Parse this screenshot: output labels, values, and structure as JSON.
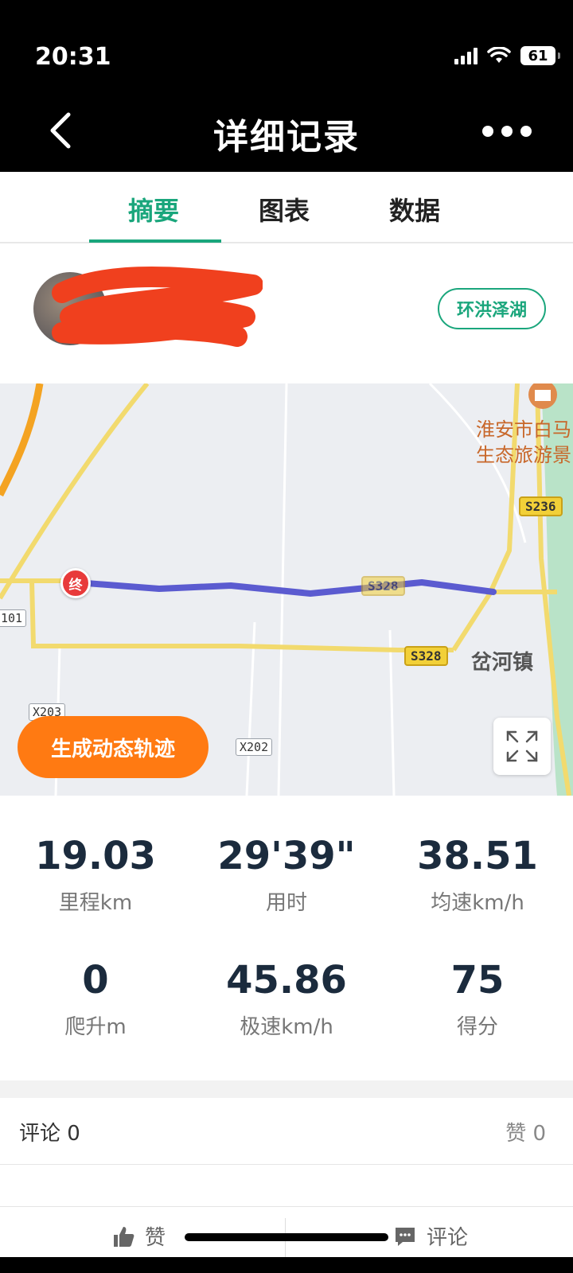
{
  "status_bar": {
    "time": "20:31",
    "battery": "61"
  },
  "header": {
    "title": "详细记录"
  },
  "tabs": [
    {
      "label": "摘要",
      "active": true
    },
    {
      "label": "图表",
      "active": false
    },
    {
      "label": "数据",
      "active": false
    }
  ],
  "user": {
    "route_tag": "环洪泽湖"
  },
  "map": {
    "poi_line1": "淮安市白马",
    "poi_line2": "生态旅游景",
    "road_s236": "S236",
    "road_s328_track": "S328",
    "road_s328": "S328",
    "road_x203": "X203",
    "road_x202": "X202",
    "road_101": "101",
    "town": "岔河镇",
    "end_marker": "终",
    "generate_button": "生成动态轨迹",
    "track_color": "#5b5bd0"
  },
  "stats": [
    {
      "value": "19.03",
      "label": "里程km"
    },
    {
      "value": "29'39\"",
      "label": "用时"
    },
    {
      "value": "38.51",
      "label": "均速km/h"
    },
    {
      "value": "0",
      "label": "爬升m"
    },
    {
      "value": "45.86",
      "label": "极速km/h"
    },
    {
      "value": "75",
      "label": "得分"
    }
  ],
  "comments": {
    "comments_label": "评论 0",
    "likes_label": "赞 0"
  },
  "bottom_bar": {
    "like": "赞",
    "comment": "评论"
  },
  "colors": {
    "accent": "#1aa67c",
    "orange": "#ff7a12"
  }
}
